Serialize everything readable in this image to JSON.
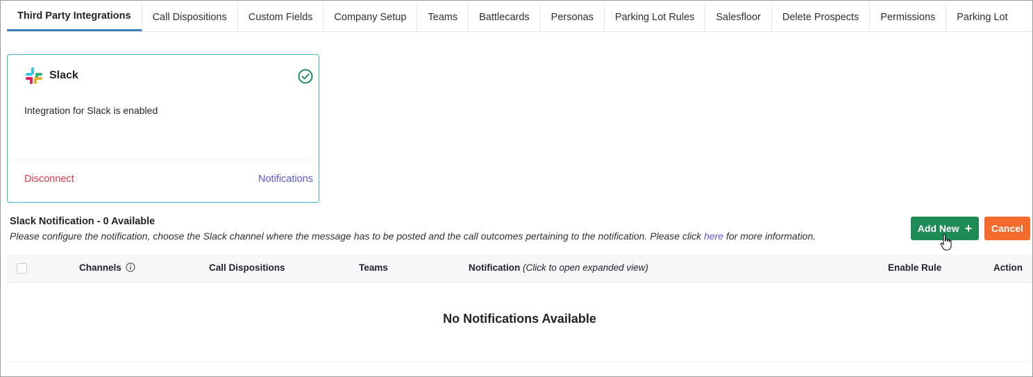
{
  "tabs": [
    {
      "label": "Third Party Integrations",
      "active": true
    },
    {
      "label": "Call Dispositions"
    },
    {
      "label": "Custom Fields"
    },
    {
      "label": "Company Setup"
    },
    {
      "label": "Teams"
    },
    {
      "label": "Battlecards"
    },
    {
      "label": "Personas"
    },
    {
      "label": "Parking Lot Rules"
    },
    {
      "label": "Salesfloor"
    },
    {
      "label": "Delete Prospects"
    },
    {
      "label": "Permissions"
    },
    {
      "label": "Parking Lot"
    }
  ],
  "card": {
    "title": "Slack",
    "description": "Integration for Slack is enabled",
    "disconnect_label": "Disconnect",
    "notifications_label": "Notifications",
    "status_icon": "check-circle-icon",
    "border_color": "#37b8c0"
  },
  "section": {
    "title": "Slack Notification - 0 Available",
    "desc_before": "Please configure the notification, choose the Slack channel where the message has to be posted and the call outcomes pertaining to the notification. Please click ",
    "desc_link": "here",
    "desc_after": " for more information."
  },
  "buttons": {
    "add_new": "Add New",
    "add_new_icon": "+",
    "cancel": "Cancel",
    "add_color": "#1e8a55",
    "cancel_color": "#f46b2e"
  },
  "table": {
    "columns": {
      "channels": "Channels",
      "call_dispositions": "Call Dispositions",
      "teams": "Teams",
      "notification": "Notification",
      "notification_hint": "(Click to open expanded view)",
      "enable_rule": "Enable Rule",
      "action": "Action"
    },
    "empty_message": "No Notifications Available"
  }
}
